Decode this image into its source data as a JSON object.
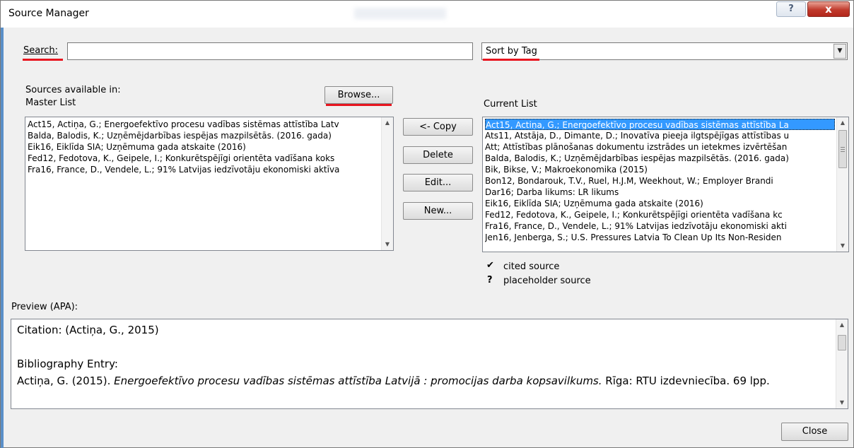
{
  "window": {
    "title": "Source Manager",
    "help_label": "?",
    "close_label": "x"
  },
  "search": {
    "label": "Search:",
    "value": "",
    "placeholder": ""
  },
  "sort": {
    "selected": "Sort by Tag"
  },
  "sources_available_label": "Sources available in:",
  "master_list": {
    "label": "Master List",
    "items": [
      "Act15, Actiņa, G.; Energoefektīvo procesu vadības sistēmas attīstība Latv",
      "Balda, Balodis, K.; Uzņēmējdarbības iespējas mazpilsētās. (2016. gada)",
      "Eik16, Eiklīda SIA; Uzņēmuma gada atskaite (2016)",
      "Fed12, Fedotova, K., Geipele, I.; Konkurētspējīgi orientēta vadīšana koks",
      "Fra16, France, D., Vendele, L.; 91% Latvijas iedzīvotāju ekonomiski aktīva"
    ]
  },
  "browse_label": "Browse...",
  "actions": {
    "copy": "<- Copy",
    "delete": "Delete",
    "edit": "Edit...",
    "new": "New..."
  },
  "current_list": {
    "label": "Current List",
    "items": [
      "Act15, Actiņa, G.; Energoefektīvo procesu vadības sistēmas attīstība La",
      "Ats11, Atstāja, D., Dimante, D.; Inovatīva pieeja ilgtspējīgas attīstības u",
      "Att; Attīstības plānošanas dokumentu izstrādes un ietekmes izvērtēšan",
      "Balda, Balodis, K.; Uzņēmējdarbības iespējas mazpilsētās. (2016. gada)",
      "Bik, Bikse, V.; Makroekonomika (2015)",
      "Bon12, Bondarouk, T.V.,  Ruel, H.J.M, Weekhout, W.; Employer Brandi",
      "Dar16; Darba likums: LR likums",
      "Eik16, Eiklīda SIA; Uzņēmuma gada atskaite (2016)",
      "Fed12, Fedotova, K., Geipele, I.; Konkurētspējīgi orientēta vadīšana kc",
      "Fra16, France, D., Vendele, L.; 91% Latvijas iedzīvotāju ekonomiski akti",
      "Jen16, Jenberga, S.; U.S. Pressures Latvia To Clean Up Its Non-Residen"
    ]
  },
  "legend": {
    "cited_glyph": "✔",
    "cited_label": "cited source",
    "placeholder_glyph": "?",
    "placeholder_label": "placeholder source"
  },
  "preview": {
    "label": "Preview (APA):",
    "citation": "Citation:  (Actiņa, G., 2015)",
    "bibliography_heading": "Bibliography Entry:",
    "entry_prefix": "Actiņa, G. (2015). ",
    "entry_title": "Energoefektīvo procesu vadības sistēmas attīstība Latvijā : promocijas darba kopsavilkums.",
    "entry_suffix": " Rīga: RTU izdevniecība. 69 lpp."
  },
  "close_button_label": "Close"
}
